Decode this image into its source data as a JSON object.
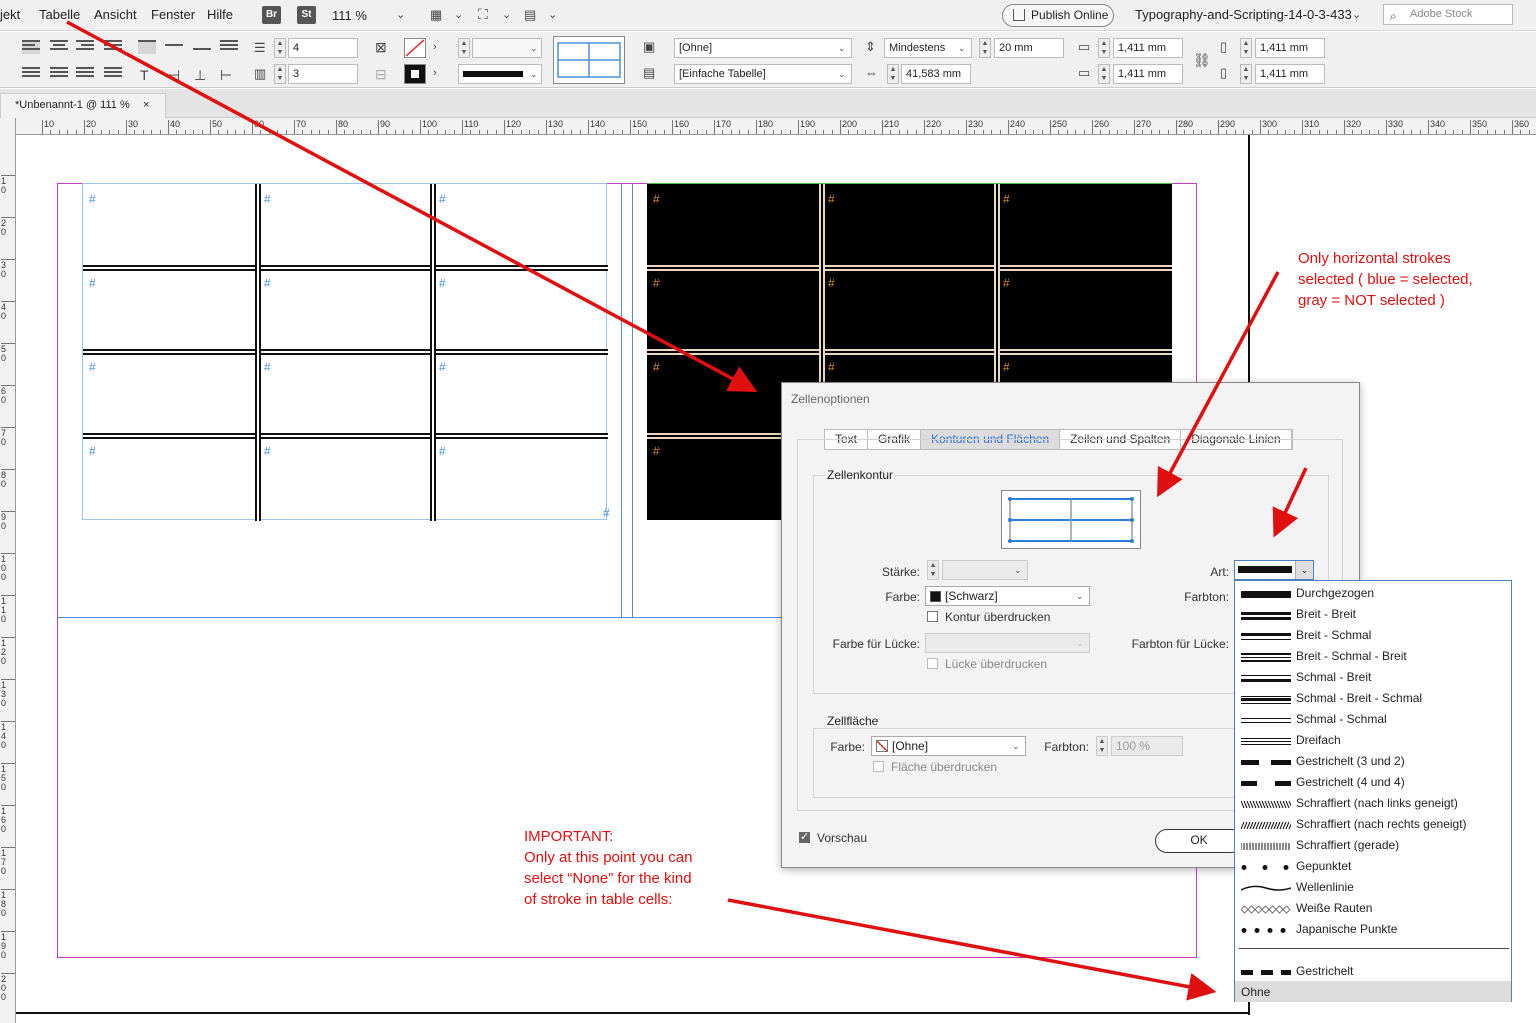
{
  "menubar": {
    "items": [
      "jekt",
      "Tabelle",
      "Ansicht",
      "Fenster",
      "Hilfe"
    ],
    "badges": [
      "Br",
      "St"
    ],
    "zoom": "111 %",
    "publish_label": "Publish Online",
    "document_title": "Typography-and-Scripting-14-0-3-433",
    "stock_placeholder": "Adobe Stock"
  },
  "controlbar": {
    "rows_value": "4",
    "cols_value": "3",
    "style_cell": "[Ohne]",
    "style_table": "[Einfache Tabelle]",
    "height_mode": "Mindestens",
    "height_value": "20 mm",
    "width_value": "41,583 mm",
    "inset_top": "1,411 mm",
    "inset_bottom": "1,411 mm",
    "inset_left": "1,411 mm",
    "inset_right": "1,411 mm"
  },
  "doc_tab": {
    "label": "*Unbenannt-1 @ 111 %",
    "close": "×"
  },
  "ruler": {
    "h_labels": [
      "10",
      "20",
      "30",
      "40",
      "50",
      "60",
      "70",
      "80",
      "90",
      "100",
      "110",
      "120",
      "130",
      "140",
      "150",
      "160",
      "170",
      "180",
      "190",
      "200",
      "210",
      "220",
      "230",
      "240",
      "250",
      "260",
      "270",
      "280",
      "290",
      "300",
      "310",
      "320",
      "330",
      "340",
      "350",
      "360"
    ],
    "v_labels": [
      "10",
      "20",
      "30",
      "40",
      "50",
      "60",
      "70",
      "80",
      "90",
      "100",
      "110",
      "120",
      "130",
      "140",
      "150",
      "160",
      "170",
      "180",
      "190",
      "200"
    ]
  },
  "table_left": {
    "cell_marker": "#"
  },
  "table_right": {
    "cell_marker": "#"
  },
  "dialog": {
    "title": "Zellenoptionen",
    "tabs": [
      "Text",
      "Grafik",
      "Konturen und Flächen",
      "Zeilen und Spalten",
      "Diagonale Linien"
    ],
    "active_tab": 2,
    "cell_stroke_label": "Zellenkontur",
    "weight_label": "Stärke:",
    "type_label": "Art:",
    "color_label": "Farbe:",
    "color_value": "[Schwarz]",
    "tint_label": "Farbton:",
    "overprint_stroke": "Kontur überdrucken",
    "gap_color_label": "Farbe für Lücke:",
    "gap_tint_label": "Farbton für Lücke:",
    "overprint_gap": "Lücke überdrucken",
    "cell_fill_label": "Zellfläche",
    "fill_color_label": "Farbe:",
    "fill_color_value": "[Ohne]",
    "fill_tint_label": "Farbton:",
    "fill_tint_value": "100 %",
    "overprint_fill": "Fläche überdrucken",
    "preview_label": "Vorschau",
    "preview_checked": true,
    "ok_label": "OK"
  },
  "stroke_types": [
    {
      "label": "Durchgezogen",
      "icon": "solid"
    },
    {
      "label": "Breit - Breit",
      "icon": "thick-thick"
    },
    {
      "label": "Breit - Schmal",
      "icon": "thick-thin"
    },
    {
      "label": "Breit - Schmal - Breit",
      "icon": "thick-thin-thick"
    },
    {
      "label": "Schmal - Breit",
      "icon": "thin-thick"
    },
    {
      "label": "Schmal - Breit - Schmal",
      "icon": "thin-thick-thin"
    },
    {
      "label": "Schmal - Schmal",
      "icon": "thin-thin"
    },
    {
      "label": "Dreifach",
      "icon": "triple"
    },
    {
      "label": "Gestrichelt (3 und 2)",
      "icon": "dashed-3-2"
    },
    {
      "label": "Gestrichelt (4 und 4)",
      "icon": "dashed-4-4"
    },
    {
      "label": "Schraffiert (nach links geneigt)",
      "icon": "hatch-left"
    },
    {
      "label": "Schraffiert (nach rechts geneigt)",
      "icon": "hatch-right"
    },
    {
      "label": "Schraffiert (gerade)",
      "icon": "hatch-straight"
    },
    {
      "label": "Gepunktet",
      "icon": "dotted"
    },
    {
      "label": "Wellenlinie",
      "icon": "wavy"
    },
    {
      "label": "Weiße Rauten",
      "icon": "white-diamond"
    },
    {
      "label": "Japanische Punkte",
      "icon": "japanese-dots"
    },
    {
      "label": "Gestrichelt",
      "icon": "dashed"
    },
    {
      "label": "Ohne",
      "icon": "none"
    }
  ],
  "annotations": {
    "horizontal_strokes": [
      "Only horizontal strokes",
      "selected ( blue = selected,",
      "gray = NOT selected )"
    ],
    "important": [
      "IMPORTANT:",
      "Only at this point you can",
      "select “None” for the kind",
      "of stroke in table cells:"
    ]
  },
  "colors": {
    "accent_blue": "#4a90d9",
    "annotation_red": "#e01010",
    "margin_magenta": "#c53cc5",
    "hash_orange": "#d58a2a"
  }
}
